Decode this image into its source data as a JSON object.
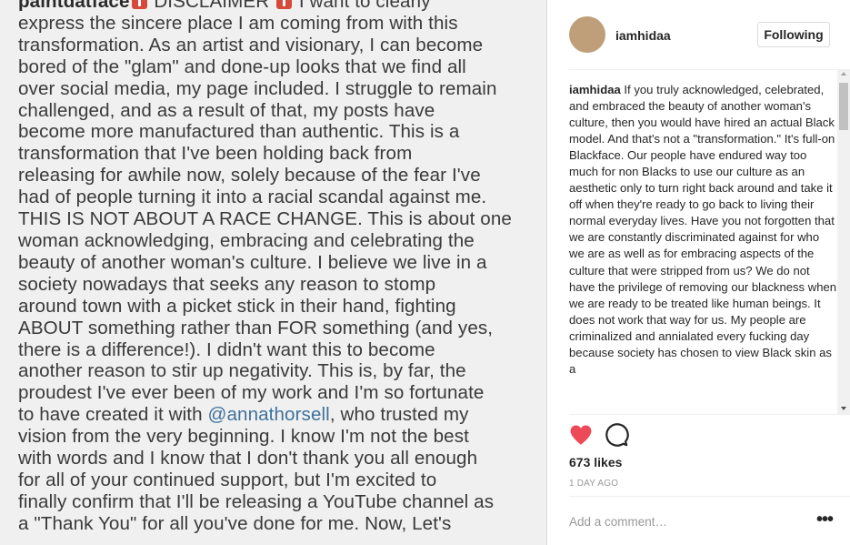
{
  "photo": {
    "lines": [
      {
        "segments": [
          {
            "text": "paintdatface",
            "kind": "uname"
          },
          {
            "kind": "emoji"
          },
          {
            "text": " DISCLAIMER ",
            "kind": "text"
          },
          {
            "kind": "emoji"
          },
          {
            "text": " I want to clearly",
            "kind": "text"
          }
        ]
      },
      {
        "segments": [
          {
            "text": "express the sincere place I am coming from with this",
            "kind": "text"
          }
        ]
      },
      {
        "segments": [
          {
            "text": "transformation. As an artist and visionary, I can become",
            "kind": "text"
          }
        ]
      },
      {
        "segments": [
          {
            "text": "bored of the \"glam\" and done-up looks that we find all",
            "kind": "text"
          }
        ]
      },
      {
        "segments": [
          {
            "text": "over social media, my page included. I struggle to remain",
            "kind": "text"
          }
        ]
      },
      {
        "segments": [
          {
            "text": "challenged, and as a result of that, my posts have",
            "kind": "text"
          }
        ]
      },
      {
        "segments": [
          {
            "text": "become more manufactured than authentic. This is a",
            "kind": "text"
          }
        ]
      },
      {
        "segments": [
          {
            "text": "transformation that I've been holding back from",
            "kind": "text"
          }
        ]
      },
      {
        "segments": [
          {
            "text": "releasing for awhile now, solely because of the fear I've",
            "kind": "text"
          }
        ]
      },
      {
        "segments": [
          {
            "text": "had of people turning it into a racial scandal against me.",
            "kind": "text"
          }
        ]
      },
      {
        "segments": [
          {
            "text": "THIS IS NOT ABOUT A RACE CHANGE. This is about one",
            "kind": "text"
          }
        ]
      },
      {
        "segments": [
          {
            "text": "woman acknowledging, embracing and celebrating the",
            "kind": "text"
          }
        ]
      },
      {
        "segments": [
          {
            "text": "beauty of another woman's culture. I believe we live in a",
            "kind": "text"
          }
        ]
      },
      {
        "segments": [
          {
            "text": "society nowadays that seeks any reason to stomp",
            "kind": "text"
          }
        ]
      },
      {
        "segments": [
          {
            "text": "around town with a picket stick in their hand, fighting",
            "kind": "text"
          }
        ]
      },
      {
        "segments": [
          {
            "text": "ABOUT something rather than FOR something (and yes,",
            "kind": "text"
          }
        ]
      },
      {
        "segments": [
          {
            "text": "there is a difference!). I didn't want this to become",
            "kind": "text"
          }
        ]
      },
      {
        "segments": [
          {
            "text": "another reason to stir up negativity. This is, by far, the",
            "kind": "text"
          }
        ]
      },
      {
        "segments": [
          {
            "text": "proudest I've ever been of my work and I'm so fortunate",
            "kind": "text"
          }
        ]
      },
      {
        "segments": [
          {
            "text": "to have created it with ",
            "kind": "text"
          },
          {
            "text": "@annathorsell",
            "kind": "mention"
          },
          {
            "text": ", who trusted my",
            "kind": "text"
          }
        ]
      },
      {
        "segments": [
          {
            "text": "vision from the very beginning. I know I'm not the best",
            "kind": "text"
          }
        ]
      },
      {
        "segments": [
          {
            "text": "with words and I know that I don't thank you all enough",
            "kind": "text"
          }
        ]
      },
      {
        "segments": [
          {
            "text": "for all of your continued support, but I'm excited to",
            "kind": "text"
          }
        ]
      },
      {
        "segments": [
          {
            "text": "finally confirm that I'll be releasing a YouTube channel as",
            "kind": "text"
          }
        ]
      },
      {
        "segments": [
          {
            "text": "a \"Thank You\" for all you've done for me. Now, Let's",
            "kind": "text"
          }
        ]
      }
    ]
  },
  "header": {
    "username": "iamhidaa",
    "follow_label": "Following",
    "avatar_color": "#bf9f7a"
  },
  "comment": {
    "username": "iamhidaa",
    "text": " If you truly acknowledged, celebrated, and embraced the beauty of another woman's culture, then you would have hired an actual Black model. And that's not a \"transformation.\" It's full-on Blackface. Our people have endured way too much for non Blacks to use our culture as an aesthetic only to turn right back around and take it off when they're ready to go back to living their normal everyday lives. Have you not forgotten that we are constantly discriminated against for who we are as well as for embracing aspects of the culture that were stripped from us? We do not have the privilege of removing our blackness when we are ready to be treated like human beings. It does not work that way for us. My people are criminalized and annialated every fucking day because society has chosen to view Black skin as a"
  },
  "actions": {
    "like_icon": "heart-icon",
    "like_color": "#ed4956",
    "comment_icon": "speech-bubble-icon"
  },
  "likes": "673 likes",
  "timestamp": "1 DAY AGO",
  "add_comment": {
    "placeholder": "Add a comment…",
    "more_label": "•••"
  }
}
